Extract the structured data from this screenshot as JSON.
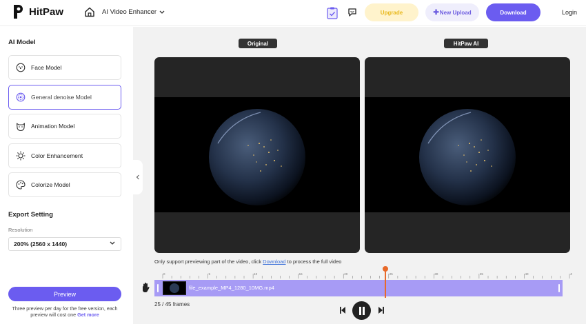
{
  "header": {
    "brand": "HitPaw",
    "product": "AI Video Enhancer",
    "upgrade": "Upgrade",
    "new_upload": "New Upload",
    "download": "Download",
    "login": "Login",
    "accent": "#6b5cf0"
  },
  "sidebar": {
    "ai_model_title": "AI Model",
    "models": [
      {
        "label": "Face Model",
        "icon": "face-icon",
        "active": false
      },
      {
        "label": "General denoise Model",
        "icon": "denoise-icon",
        "active": true
      },
      {
        "label": "Animation Model",
        "icon": "animation-icon",
        "active": false
      },
      {
        "label": "Color Enhancement",
        "icon": "sun-icon",
        "active": false
      },
      {
        "label": "Colorize Model",
        "icon": "palette-icon",
        "active": false
      }
    ],
    "export_title": "Export Setting",
    "resolution_label": "Resolution",
    "resolution_value": "200% (2560 x 1440)",
    "preview_button": "Preview",
    "preview_note": "Three preview per day for the free version, each preview will cost one",
    "get_more": "Get more"
  },
  "viewer": {
    "original_tag": "Original",
    "ai_tag": "HitPaw AI",
    "notice_pre": "Only support previewing part of the video, click",
    "notice_link": "Download",
    "notice_post": "to process the full video"
  },
  "timeline": {
    "clip_name": "file_example_MP4_1280_10MG.mp4",
    "ruler_labels": [
      "0",
      "5",
      "10",
      "15",
      "20",
      "25",
      "30",
      "35",
      "40",
      "45"
    ],
    "current_frame": "25",
    "total_frames": "45",
    "frames_text": "25 / 45 frames",
    "playhead_color": "#e86a2a"
  }
}
